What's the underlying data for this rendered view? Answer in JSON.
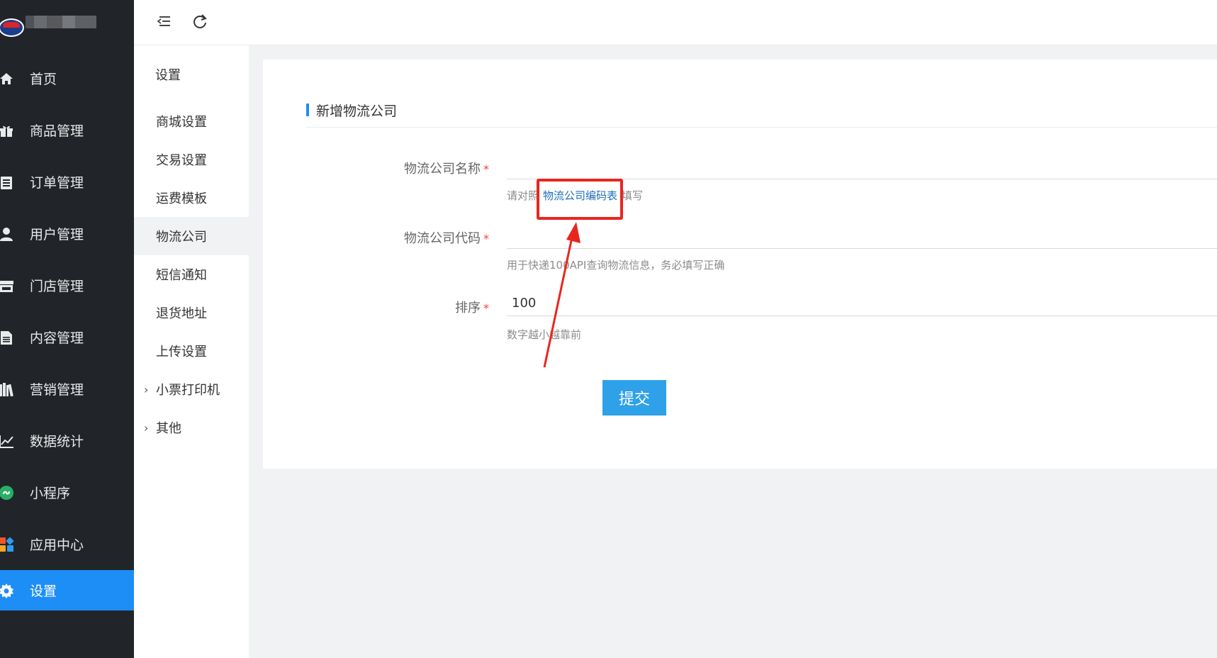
{
  "sidebar": {
    "items": [
      {
        "label": "首页",
        "icon": "home-icon"
      },
      {
        "label": "商品管理",
        "icon": "gift-icon"
      },
      {
        "label": "订单管理",
        "icon": "clipboard-icon"
      },
      {
        "label": "用户管理",
        "icon": "user-icon"
      },
      {
        "label": "门店管理",
        "icon": "store-icon"
      },
      {
        "label": "内容管理",
        "icon": "document-icon"
      },
      {
        "label": "营销管理",
        "icon": "books-icon"
      },
      {
        "label": "数据统计",
        "icon": "line-chart-icon"
      },
      {
        "label": "小程序",
        "icon": "miniprogram-icon"
      },
      {
        "label": "应用中心",
        "icon": "apps-icon"
      },
      {
        "label": "设置",
        "icon": "gear-icon",
        "active": true
      }
    ]
  },
  "topbar": {
    "icons": [
      "menu-fold-icon",
      "refresh-icon"
    ]
  },
  "submenu": {
    "title": "设置",
    "items": [
      {
        "label": "商城设置"
      },
      {
        "label": "交易设置"
      },
      {
        "label": "运费模板"
      },
      {
        "label": "物流公司",
        "active": true
      },
      {
        "label": "短信通知"
      },
      {
        "label": "退货地址"
      },
      {
        "label": "上传设置"
      },
      {
        "label": "小票打印机",
        "expandable": true
      },
      {
        "label": "其他",
        "expandable": true
      }
    ]
  },
  "form": {
    "title": "新增物流公司",
    "required_mark": "*",
    "name": {
      "label": "物流公司名称",
      "value": "",
      "help_prefix": "请对照",
      "help_link": "物流公司编码表",
      "help_suffix": "填写"
    },
    "code": {
      "label": "物流公司代码",
      "value": "",
      "help": "用于快递100API查询物流信息，务必填写正确"
    },
    "sort": {
      "label": "排序",
      "value": "100",
      "help": "数字越小越靠前"
    },
    "submit_label": "提交"
  },
  "colors": {
    "sidebar_bg": "#212529",
    "accent": "#1e8ef7",
    "submit": "#2ea1e8",
    "required": "#ff3b3b",
    "annotation": "#e8261f"
  }
}
